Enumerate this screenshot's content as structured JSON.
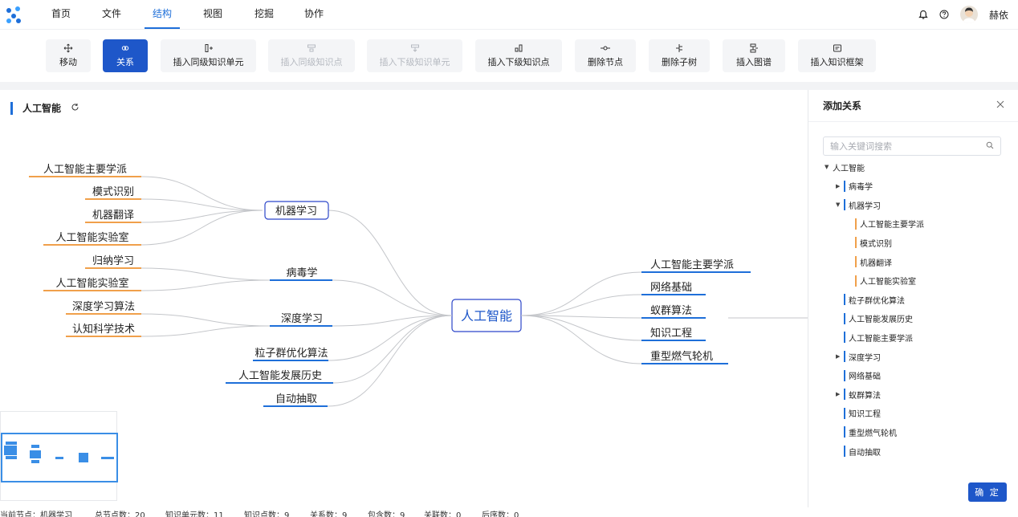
{
  "nav": {
    "tabs": [
      "首页",
      "文件",
      "结构",
      "视图",
      "挖掘",
      "协作"
    ],
    "active_tab": "结构",
    "user": "赫依"
  },
  "toolbar": {
    "buttons": [
      {
        "label": "移动",
        "state": "normal"
      },
      {
        "label": "关系",
        "state": "active"
      },
      {
        "label": "插入同级知识单元",
        "state": "normal"
      },
      {
        "label": "插入同级知识点",
        "state": "disabled"
      },
      {
        "label": "插入下级知识单元",
        "state": "disabled"
      },
      {
        "label": "插入下级知识点",
        "state": "normal"
      },
      {
        "label": "删除节点",
        "state": "normal"
      },
      {
        "label": "删除子树",
        "state": "normal"
      },
      {
        "label": "插入图谱",
        "state": "normal"
      },
      {
        "label": "插入知识框架",
        "state": "normal"
      }
    ]
  },
  "canvas": {
    "title": "人工智能",
    "root": "人工智能",
    "left_branches": [
      {
        "label": "机器学习",
        "selected": true,
        "children": [
          "人工智能主要学派",
          "模式识别",
          "机器翻译",
          "人工智能实验室"
        ]
      },
      {
        "label": "病毒学",
        "children": [
          "归纳学习",
          "人工智能实验室"
        ]
      },
      {
        "label": "深度学习",
        "children": [
          "深度学习算法",
          "认知科学技术"
        ]
      },
      {
        "label": "粒子群优化算法",
        "children": []
      },
      {
        "label": "人工智能发展历史",
        "children": []
      },
      {
        "label": "自动抽取",
        "children": []
      }
    ],
    "right_branches": [
      "人工智能主要学派",
      "网络基础",
      "蚁群算法",
      "知识工程",
      "重型燃气轮机"
    ]
  },
  "panel": {
    "title": "添加关系",
    "search_placeholder": "输入关键词搜索",
    "confirm": "确 定",
    "tree": [
      {
        "label": "人工智能",
        "level": 0,
        "caret": "down",
        "bar": ""
      },
      {
        "label": "病毒学",
        "level": 1,
        "caret": "right",
        "bar": "#1e6fd9"
      },
      {
        "label": "机器学习",
        "level": 1,
        "caret": "down",
        "bar": "#1e6fd9"
      },
      {
        "label": "人工智能主要学派",
        "level": 2,
        "caret": "",
        "bar": "#f0a04b"
      },
      {
        "label": "模式识别",
        "level": 2,
        "caret": "",
        "bar": "#f0a04b"
      },
      {
        "label": "机器翻译",
        "level": 2,
        "caret": "",
        "bar": "#f0a04b"
      },
      {
        "label": "人工智能实验室",
        "level": 2,
        "caret": "",
        "bar": "#f0a04b"
      },
      {
        "label": "粒子群优化算法",
        "level": 1,
        "caret": "",
        "bar": "#1e6fd9"
      },
      {
        "label": "人工智能发展历史",
        "level": 1,
        "caret": "",
        "bar": "#1e6fd9"
      },
      {
        "label": "人工智能主要学派",
        "level": 1,
        "caret": "",
        "bar": "#1e6fd9"
      },
      {
        "label": "深度学习",
        "level": 1,
        "caret": "right",
        "bar": "#1e6fd9"
      },
      {
        "label": "网络基础",
        "level": 1,
        "caret": "",
        "bar": "#1e6fd9"
      },
      {
        "label": "蚁群算法",
        "level": 1,
        "caret": "right",
        "bar": "#1e6fd9"
      },
      {
        "label": "知识工程",
        "level": 1,
        "caret": "",
        "bar": "#1e6fd9"
      },
      {
        "label": "重型燃气轮机",
        "level": 1,
        "caret": "",
        "bar": "#1e6fd9"
      },
      {
        "label": "自动抽取",
        "level": 1,
        "caret": "",
        "bar": "#1e6fd9"
      }
    ]
  },
  "status": [
    "当前节点：机器学习",
    "总节点数：20",
    "知识单元数：11",
    "知识点数：9",
    "关系数：9",
    "包含数：9",
    "关联数：0",
    "后序数：0"
  ],
  "colors": {
    "accent": "#1e57c9",
    "blue_line": "#1e6fd9",
    "orange_line": "#f0a04b",
    "edge": "#c4c6ca"
  }
}
